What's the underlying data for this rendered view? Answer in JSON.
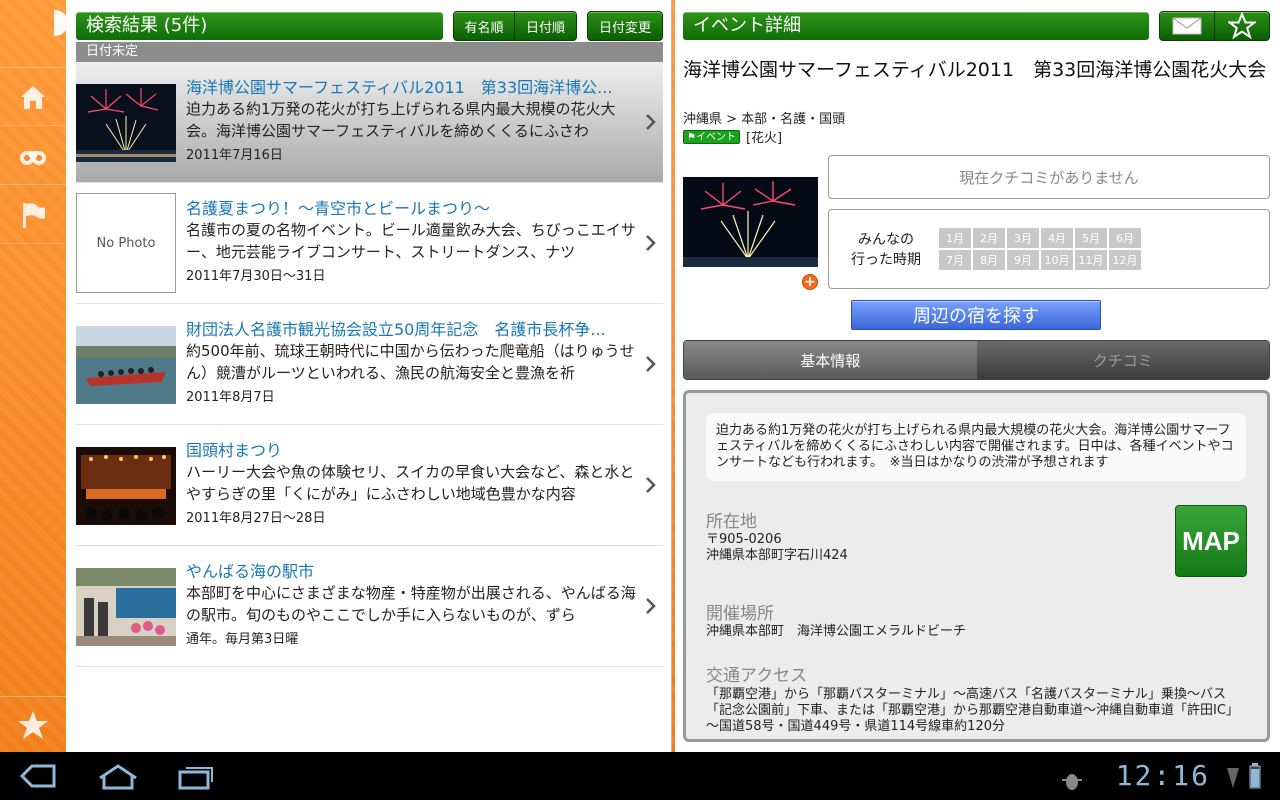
{
  "left_panel": {
    "header_title": "検索結果 (5件)",
    "sort_buttons": [
      "有名順",
      "日付順"
    ],
    "date_change": "日付変更",
    "section_label": "日付未定",
    "results": [
      {
        "title": "海洋博公園サマーフェスティバル2011　第33回海洋博公...",
        "desc": "迫力ある約1万発の花火が打ち上げられる県内最大規模の花火大会。海洋博公園サマーフェスティバルを締めくくるにふさわ",
        "date": "2011年7月16日",
        "photo": "fireworks"
      },
      {
        "title": "名護夏まつり！～青空市とビールまつり～",
        "desc": "名護市の夏の名物イベント。ビール適量飲み大会、ちびっこエイサー、地元芸能ライブコンサート、ストリートダンス、ナツ",
        "date": "2011年7月30日～31日",
        "photo_label": "No Photo"
      },
      {
        "title": "財団法人名護市観光協会設立50周年記念　名護市長杯争...",
        "desc": "約500年前、琉球王朝時代に中国から伝わった爬竜船（はりゅうせん）競漕がルーツといわれる、漁民の航海安全と豊漁を祈",
        "date": "2011年8月7日",
        "photo": "boat-race"
      },
      {
        "title": "国頭村まつり",
        "desc": "ハーリー大会や魚の体験セリ、スイカの早食い大会など、森と水とやすらぎの里「くにがみ」にふさわしい地域色豊かな内容",
        "date": "2011年8月27日～28日",
        "photo": "festival-stage"
      },
      {
        "title": "やんばる海の駅市",
        "desc": "本部町を中心にさまざまな物産・特産物が出展される、やんばる海の駅市。旬のものやここでしか手に入らないものが、ずら",
        "date": "通年。毎月第3日曜",
        "photo": "market"
      }
    ]
  },
  "right_panel": {
    "header_title": "イベント詳細",
    "title": "海洋博公園サマーフェスティバル2011　第33回海洋博公園花火大会",
    "breadcrumb": "沖縄県 > 本部・名護・国頭",
    "event_tag": "イベント",
    "category": "[花火]",
    "no_review": "現在クチコミがありません",
    "when_label": "みんなの\n行った時期",
    "months": [
      "1月",
      "2月",
      "3月",
      "4月",
      "5月",
      "6月",
      "7月",
      "8月",
      "9月",
      "10月",
      "11月",
      "12月"
    ],
    "find_inn": "周辺の宿を探す",
    "tabs": [
      "基本情報",
      "クチコミ"
    ],
    "summary": "迫力ある約1万発の花火が打ち上げられる県内最大規模の花火大会。海洋博公園サマーフェスティバルを締めくくるにふさわしい内容で開催されます。日中は、各種イベントやコンサートなども行われます。　※当日はかなりの渋滞が予想されます",
    "location_heading": "所在地",
    "postal": "〒905-0206",
    "address": "沖縄県本部町字石川424",
    "map_label": "MAP",
    "venue_heading": "開催場所",
    "venue": "沖縄県本部町　海洋博公園エメラルドビーチ",
    "access_heading": "交通アクセス",
    "access": "「那覇空港」から「那覇バスターミナル」～高速バス「名護バスターミナル」乗換～バス「記念公園前」下車、または「那覇空港」から那覇空港自動車道～沖縄自動車道「許田IC」～国道58号・国道449号・県道114号線車約120分"
  },
  "system_bar": {
    "clock": "12:16"
  },
  "colors": {
    "header_green": "#1a7f0e",
    "link_blue": "#1779b7",
    "sidebar_orange": "#ff8f2c",
    "inn_button_blue": "#4a78e8"
  }
}
